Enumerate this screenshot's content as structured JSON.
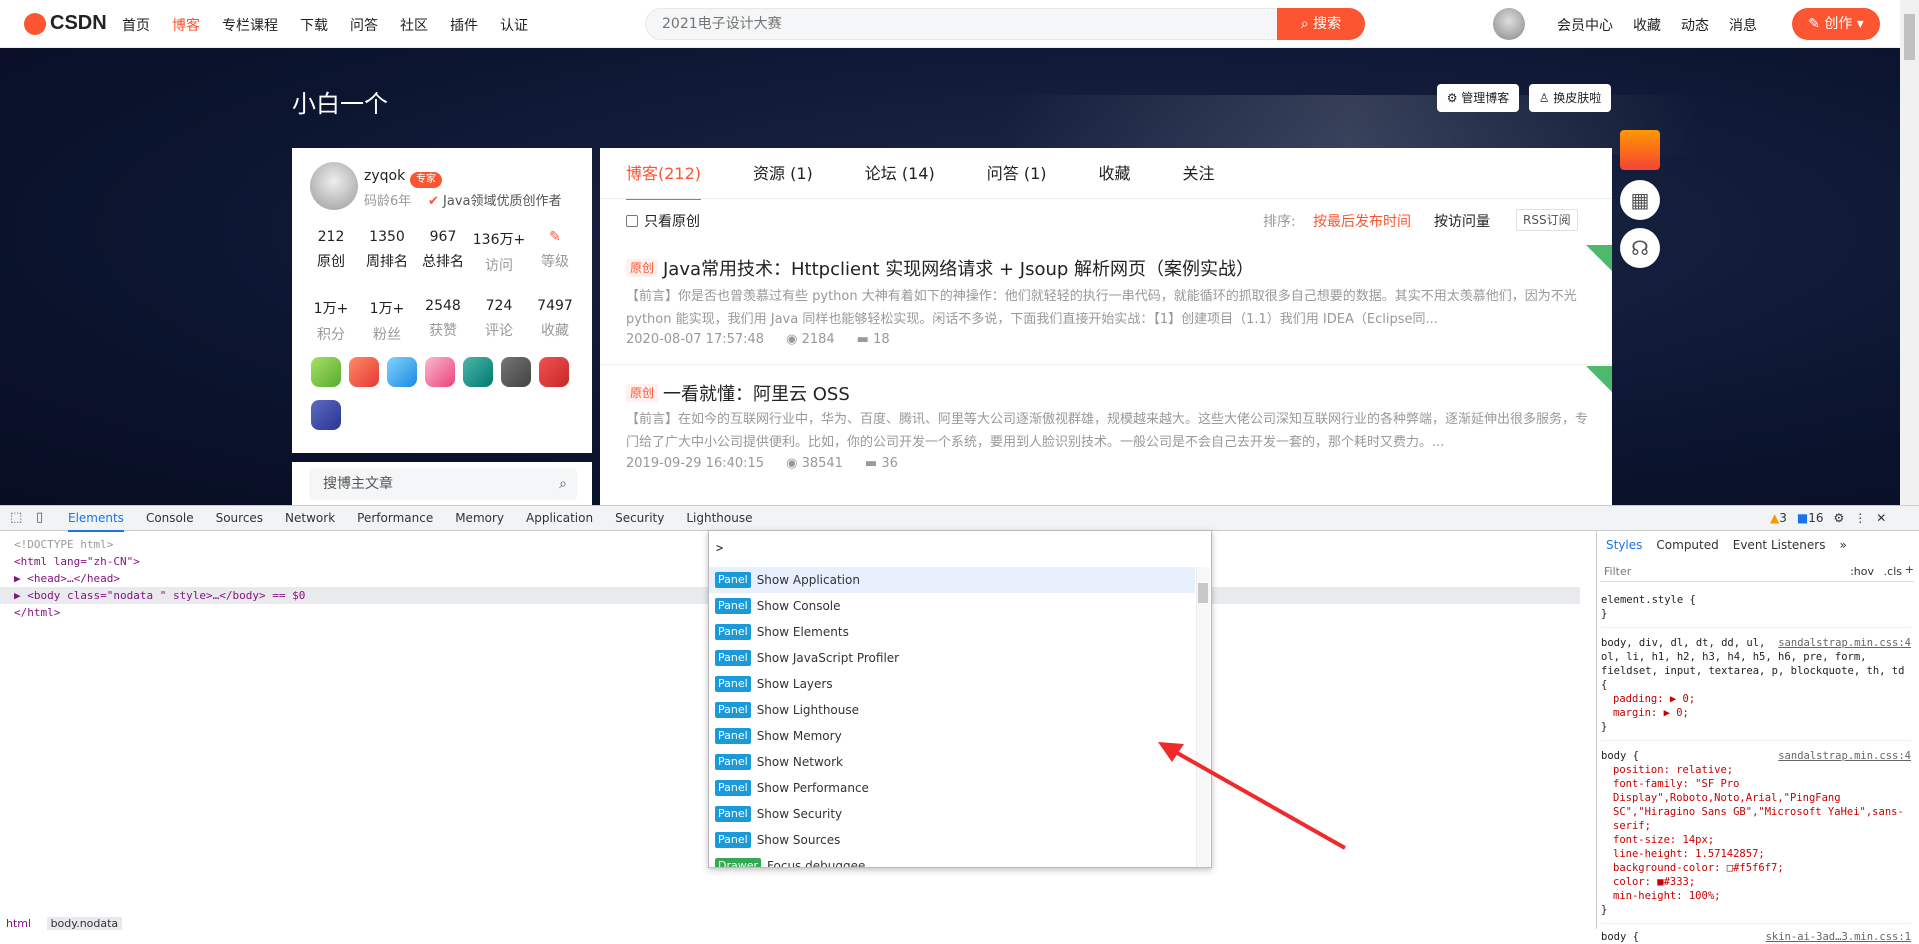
{
  "topbar": {
    "logo": "CSDN",
    "nav": [
      "首页",
      "博客",
      "专栏课程",
      "下载",
      "问答",
      "社区",
      "插件",
      "认证"
    ],
    "search_placeholder": "2021电子设计大赛",
    "search_button": "搜索",
    "right_nav": [
      "会员中心",
      "收藏",
      "动态",
      "消息"
    ],
    "create_button": "创作",
    "accent_color": "#fc5531"
  },
  "banner": {
    "blog_title": "小白一个",
    "manage_button": "管理博客",
    "skin_button": "换皮肤啦"
  },
  "profile": {
    "username": "zyqok",
    "expert_badge": "专家",
    "age": "码龄6年",
    "creator": "Java领域优质创作者",
    "stats_row1": [
      {
        "value": "212",
        "label": "原创"
      },
      {
        "value": "1350",
        "label": "周排名"
      },
      {
        "value": "967",
        "label": "总排名"
      },
      {
        "value": "136万+",
        "label": "访问"
      },
      {
        "value": "",
        "label": "等级"
      }
    ],
    "stats_row2": [
      {
        "value": "1万+",
        "label": "积分"
      },
      {
        "value": "1万+",
        "label": "粉丝"
      },
      {
        "value": "2548",
        "label": "获赞"
      },
      {
        "value": "724",
        "label": "评论"
      },
      {
        "value": "7497",
        "label": "收藏"
      }
    ],
    "search_placeholder": "搜博主文章"
  },
  "main": {
    "tabs": [
      "博客(212)",
      "资源 (1)",
      "论坛 (14)",
      "问答 (1)",
      "收藏",
      "关注"
    ],
    "original_only": "只看原创",
    "sort_label": "排序:",
    "sort_time": "按最后发布时间",
    "sort_views": "按访问量",
    "rss": "RSS订阅",
    "articles": [
      {
        "tag": "原创",
        "title": "Java常用技术：Httpclient 实现网络请求 + Jsoup 解析网页（案例实战）",
        "desc": "【前言】你是否也曾羡慕过有些 python 大神有着如下的神操作：他们就轻轻的执行一串代码，就能循环的抓取很多自己想要的数据。其实不用太羡慕他们，因为不光 python 能实现，我们用 Java 同样也能够轻松实现。闲话不多说，下面我们直接开始实战：【1】创建项目（1.1）我们用 IDEA（Eclipse同...",
        "date": "2020-08-07 17:57:48",
        "views": "2184",
        "comments": "18"
      },
      {
        "tag": "原创",
        "title": "一看就懂：阿里云 OSS",
        "desc": "【前言】在如今的互联网行业中，华为、百度、腾讯、阿里等大公司逐渐傲视群雄，规模越来越大。这些大佬公司深知互联网行业的各种弊端，逐渐延伸出很多服务，专门给了广大中小公司提供便利。比如，你的公司开发一个系统，要用到人脸识别技术。一般公司是不会自己去开发一套的，那个耗时又费力。...",
        "date": "2019-09-29 16:40:15",
        "views": "38541",
        "comments": "36"
      }
    ]
  },
  "devtools": {
    "tabs": [
      "Elements",
      "Console",
      "Sources",
      "Network",
      "Performance",
      "Memory",
      "Application",
      "Security",
      "Lighthouse"
    ],
    "warnings": "3",
    "messages": "16",
    "dom_lines": [
      "<!DOCTYPE html>",
      "<html lang=\"zh-CN\">",
      "▶ <head>…</head>",
      "▶ <body class=\"nodata \" style>…</body> == $0",
      "</html>"
    ],
    "command_input": ">",
    "commands": [
      {
        "pill": "Panel",
        "label": "Show Application"
      },
      {
        "pill": "Panel",
        "label": "Show Console"
      },
      {
        "pill": "Panel",
        "label": "Show Elements"
      },
      {
        "pill": "Panel",
        "label": "Show JavaScript Profiler"
      },
      {
        "pill": "Panel",
        "label": "Show Layers"
      },
      {
        "pill": "Panel",
        "label": "Show Lighthouse"
      },
      {
        "pill": "Panel",
        "label": "Show Memory"
      },
      {
        "pill": "Panel",
        "label": "Show Network"
      },
      {
        "pill": "Panel",
        "label": "Show Performance"
      },
      {
        "pill": "Panel",
        "label": "Show Security"
      },
      {
        "pill": "Panel",
        "label": "Show Sources"
      },
      {
        "pill": "Drawer",
        "label": "Focus debuggee"
      }
    ],
    "styles_tabs": [
      "Styles",
      "Computed",
      "Event Listeners",
      "»"
    ],
    "filter_placeholder": "Filter",
    "hov": ":hov",
    "cls": ".cls",
    "css_rules": [
      {
        "selector": "element.style {",
        "source": "",
        "lines": [
          "}"
        ]
      },
      {
        "selector": "body, div, dl, dt, dd, ul, ol, li, h1, h2, h3, h4, h5, h6, pre, form, fieldset, input, textarea, p, blockquote, th, td {",
        "source": "sandalstrap.min.css:4",
        "lines": [
          "padding: ▶ 0;",
          "margin: ▶ 0;",
          "}"
        ]
      },
      {
        "selector": "body {",
        "source": "sandalstrap.min.css:4",
        "lines": [
          "position: relative;",
          "font-family: \"SF Pro Display\",Roboto,Noto,Arial,\"PingFang SC\",\"Hiragino Sans GB\",\"Microsoft YaHei\",sans-serif;",
          "font-size: 14px;",
          "line-height: 1.57142857;",
          "background-color: □#f5f6f7;",
          "color: ■#333;",
          "min-height: 100%;",
          "}"
        ]
      },
      {
        "selector": "body {",
        "source": "skin-ai-3ad…3.min.css:1",
        "lines": []
      }
    ],
    "breadcrumbs": [
      "html",
      "body.nodata"
    ]
  }
}
